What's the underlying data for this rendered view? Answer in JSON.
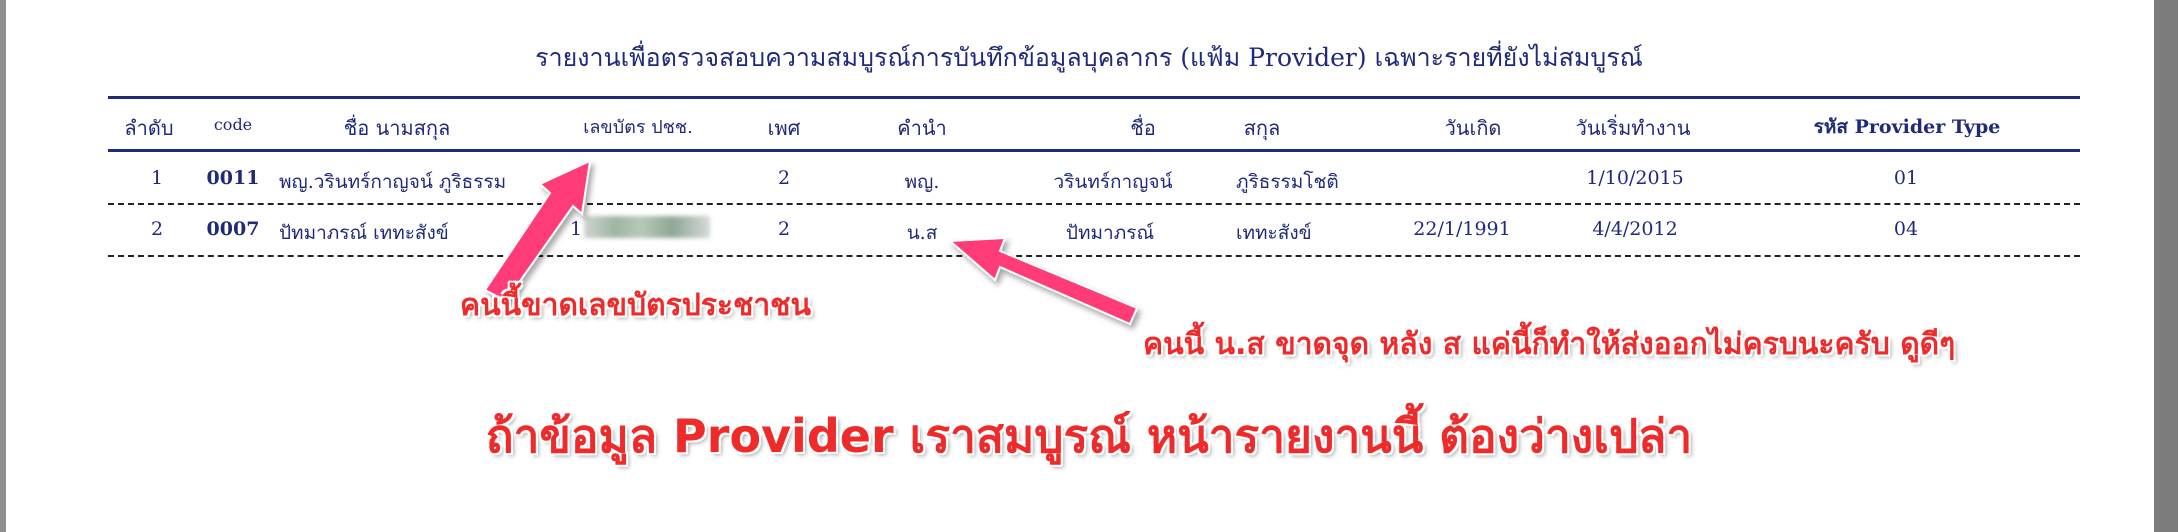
{
  "report": {
    "title": "รายงานเพื่อตรวจสอบความสมบูรณ์การบันทึกข้อมูลบุคลากร (แฟ้ม Provider) เฉพาะรายที่ยังไม่สมบูรณ์"
  },
  "table": {
    "headers": {
      "seq": "ลำดับ",
      "code": "code",
      "fullname": "ชื่อ นามสกุล",
      "cid": "เลขบัตร ปชช.",
      "sex": "เพศ",
      "prefix": "คำนำ",
      "fname": "ชื่อ",
      "lname": "สกุล",
      "birth": "วันเกิด",
      "startdate": "วันเริ่มทำงาน",
      "ptype": "รหัส Provider Type"
    },
    "rows": [
      {
        "seq": "1",
        "code": "0011",
        "fullname": "พญ.วรินทร์กาญจน์ ภูริธรรม",
        "cid": "",
        "sex": "2",
        "prefix": "พญ.",
        "fname": "วรินทร์กาญจน์",
        "lname": "ภูริธรรมโชติ",
        "birth": "",
        "startdate": "1/10/2015",
        "ptype": "01"
      },
      {
        "seq": "2",
        "code": "0007",
        "fullname": "ปัทมาภรณ์ เททะสังข์",
        "cid": "1",
        "sex": "2",
        "prefix": "น.ส",
        "fname": "ปัทมาภรณ์",
        "lname": "เททะสังข์",
        "birth": "22/1/1991",
        "startdate": "4/4/2012",
        "ptype": "04"
      }
    ]
  },
  "annotations": {
    "missing_id": "คนนี้ขาดเลขบัตรประชาชน",
    "missing_dot": "คนนี้ น.ส ขาดจุด หลัง ส แค่นี้ก็ทำให้ส่งออกไม่ครบนะครับ ดูดีๆ",
    "conclusion": "ถ้าข้อมูล Provider เราสมบูรณ์ หน้ารายงานนี้ ต้องว่างเปล่า"
  },
  "colors": {
    "report_text": "#1f2a7a",
    "annotation": "#ef2a2a",
    "arrow": "#ff3b78"
  }
}
